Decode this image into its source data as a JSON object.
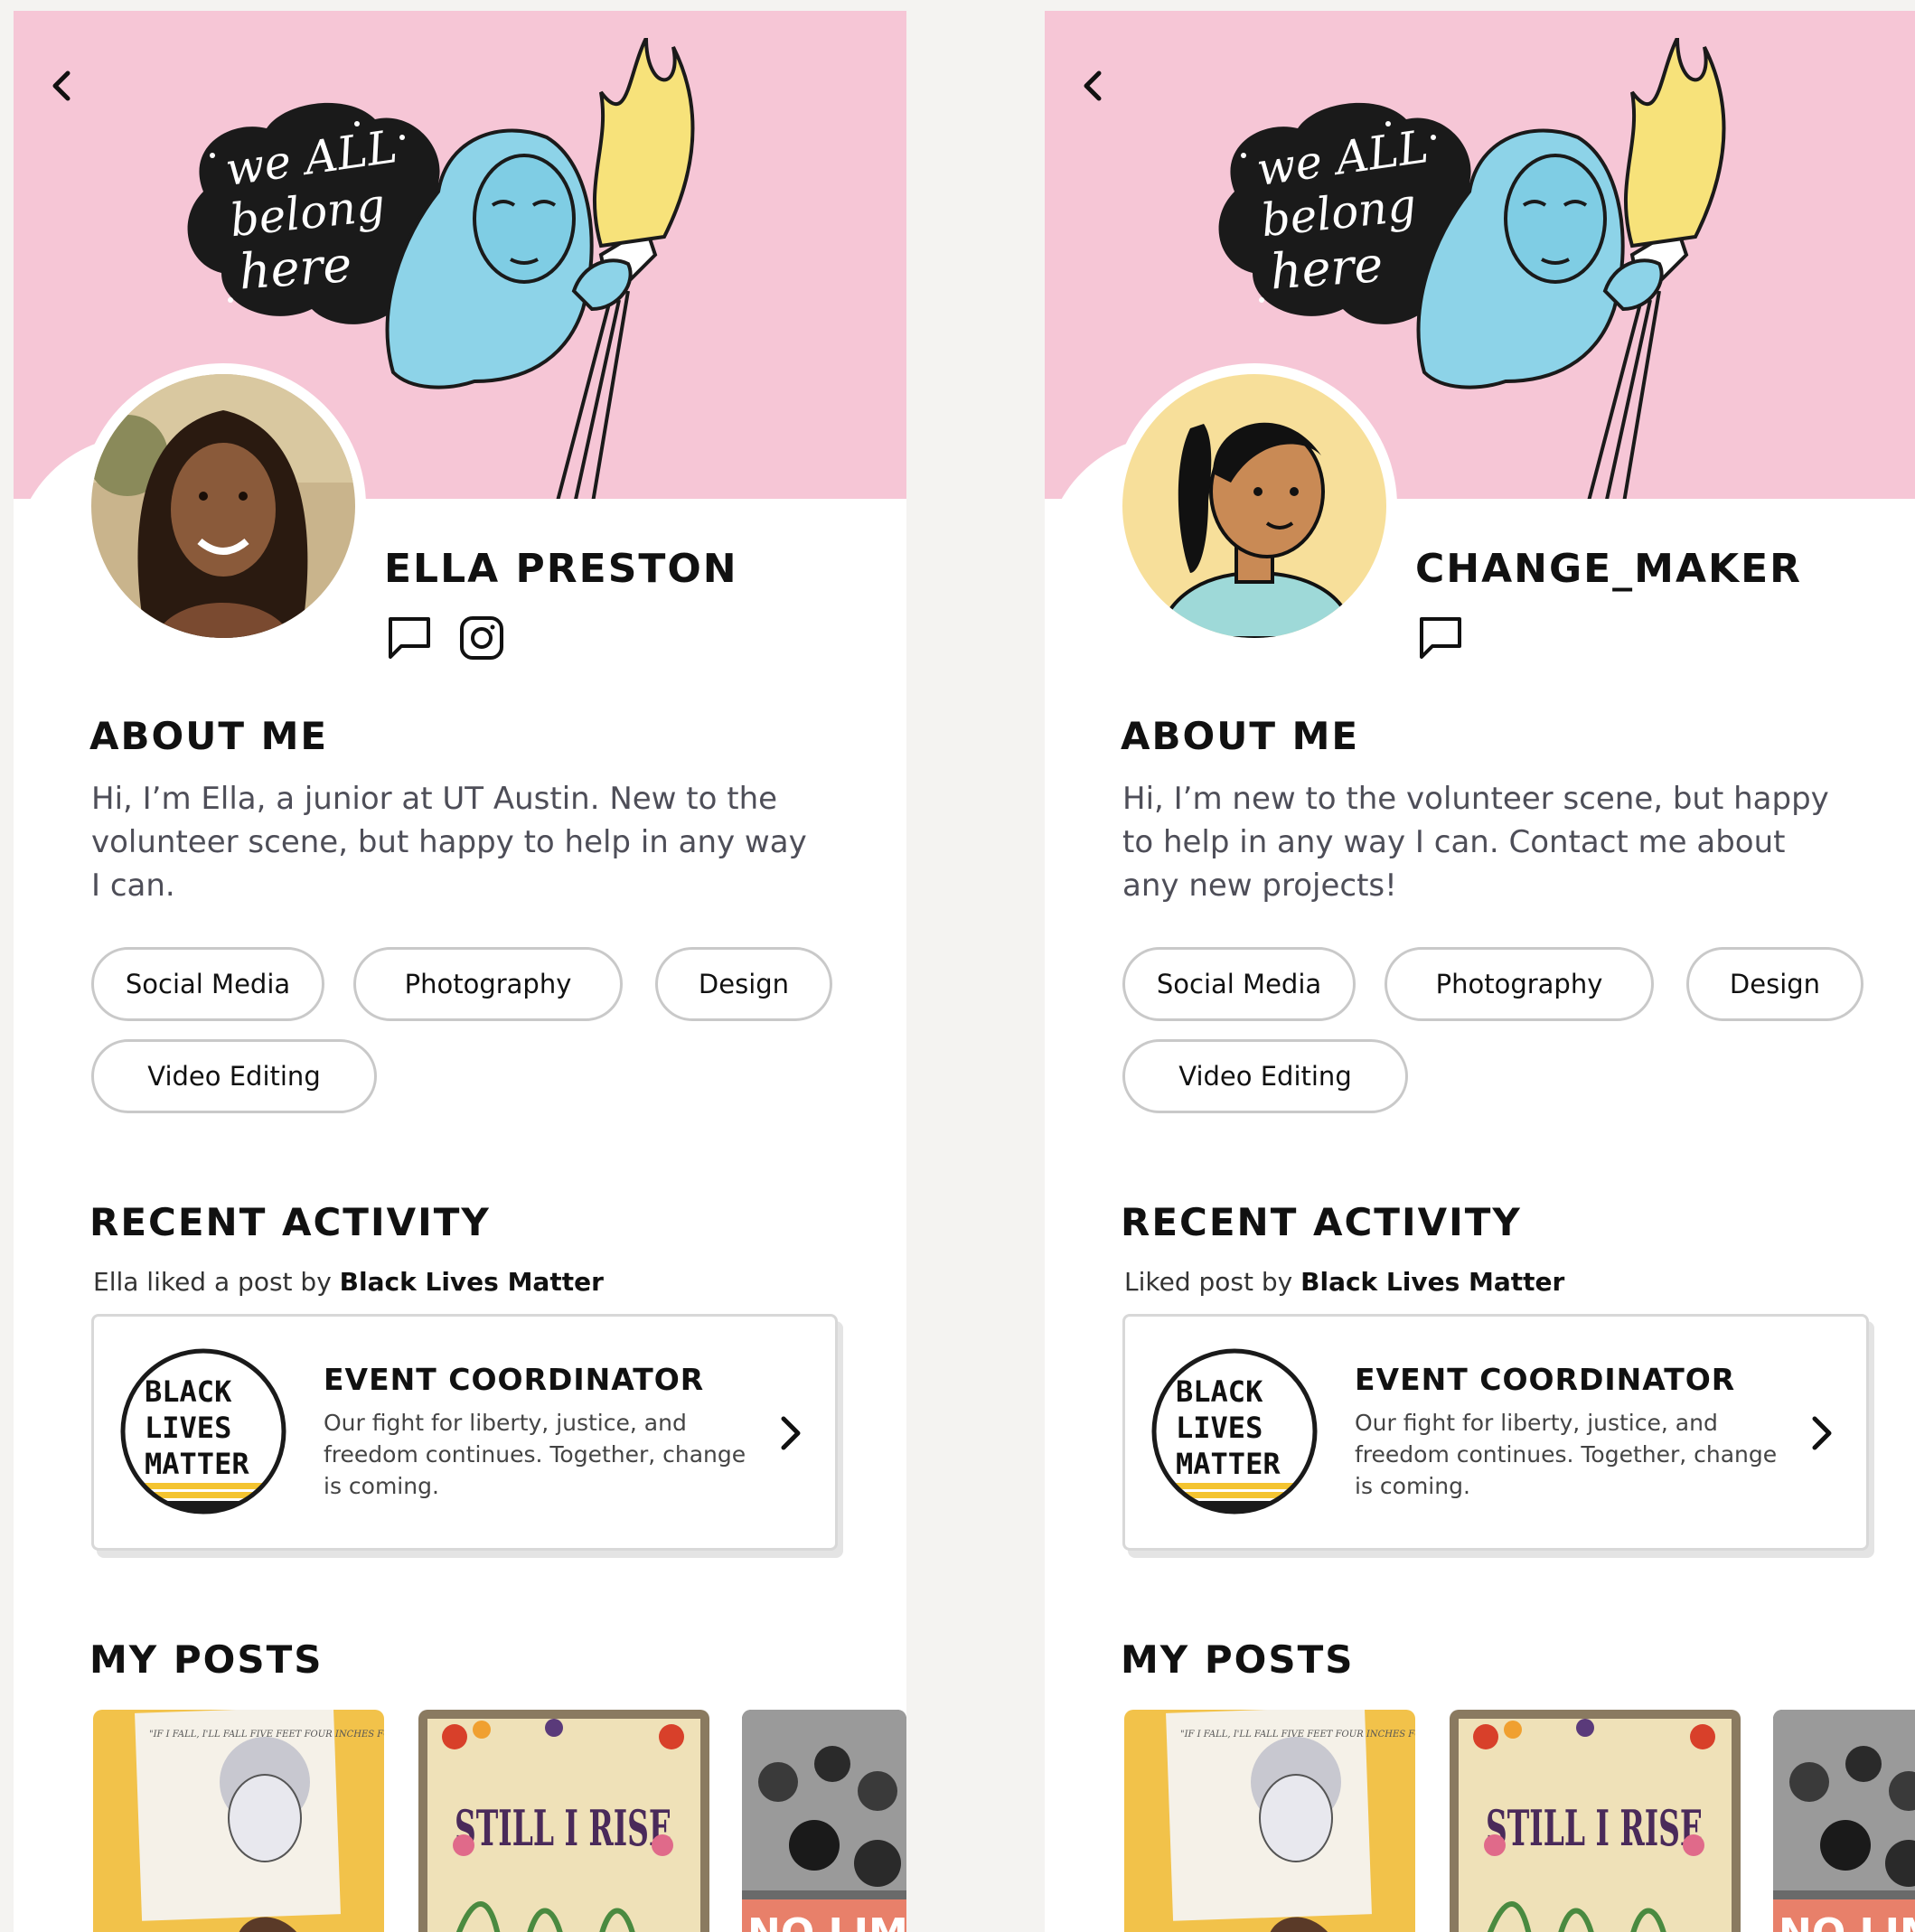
{
  "colors": {
    "banner_bg": "#f6c6d6",
    "chip_border": "#c9c9c9",
    "body_text": "#4e4e58",
    "accent_yellow": "#f4c430"
  },
  "banner_art": {
    "lines": [
      "we ALL",
      "belong",
      "here"
    ]
  },
  "profiles": [
    {
      "username": "ELLA PRESTON",
      "social_icons": [
        "message-icon",
        "instagram-icon"
      ],
      "about_heading": "ABOUT ME",
      "about_text": "Hi, I’m Ella, a junior at UT Austin. New to the volunteer scene, but happy to help in any way I can.",
      "skills": [
        "Social Media",
        "Photography",
        "Design",
        "Video Editing"
      ],
      "activity_heading": "RECENT ACTIVITY",
      "activity_prefix": "Ella liked a post by",
      "activity_org": "Black Lives Matter",
      "card": {
        "logo_lines": [
          "BLACK",
          "LIVES",
          "MATTER"
        ],
        "title": "EVENT COORDINATOR",
        "text": "Our fight for liberty, justice, and freedom continues. Together, change is coming."
      },
      "posts_heading": "MY POSTS",
      "posts": [
        {
          "label": "\"IF I FALL, I'LL FALL FIVE FEET FOUR INCHES FORWARD IN THE FIGHT FOR FREEDOM. I'M NOT BACKING OFF\""
        },
        {
          "label": "STILL I RISE"
        },
        {
          "label": "NO LIMIT"
        }
      ]
    },
    {
      "username": "CHANGE_MAKER",
      "social_icons": [
        "message-icon"
      ],
      "about_heading": "ABOUT ME",
      "about_text": "Hi, I’m new to the volunteer scene, but happy to help in any way I can. Contact me about any new projects!",
      "skills": [
        "Social Media",
        "Photography",
        "Design",
        "Video Editing"
      ],
      "activity_heading": "RECENT ACTIVITY",
      "activity_prefix": "Liked post by",
      "activity_org": "Black Lives Matter",
      "card": {
        "logo_lines": [
          "BLACK",
          "LIVES",
          "MATTER"
        ],
        "title": "EVENT COORDINATOR",
        "text": "Our fight for liberty, justice, and freedom continues. Together, change is coming."
      },
      "posts_heading": "MY POSTS",
      "posts": [
        {
          "label": "\"IF I FALL, I'LL FALL FIVE FEET FOUR INCHES FORWARD IN THE FIGHT FOR FREEDOM. I'M NOT BACKING OFF\""
        },
        {
          "label": "STILL I RISE"
        },
        {
          "label": "NO LIMIT"
        }
      ]
    }
  ]
}
